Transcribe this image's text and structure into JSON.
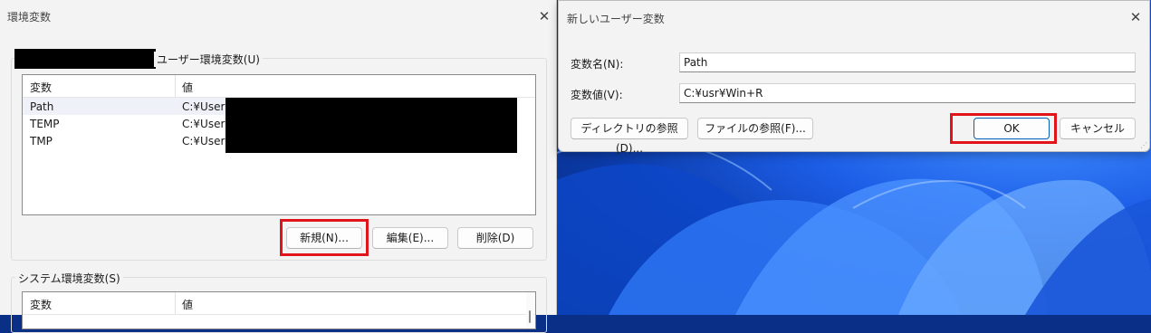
{
  "env_dialog": {
    "title": "環境変数",
    "user_section": {
      "label": "ユーザー環境変数(U)",
      "columns": [
        "変数",
        "値"
      ],
      "rows": [
        {
          "name": "Path",
          "value": "C:¥Users¥"
        },
        {
          "name": "TEMP",
          "value": "C:¥Users¥"
        },
        {
          "name": "TMP",
          "value": "C:¥Users¥"
        }
      ],
      "buttons": {
        "new": "新規(N)...",
        "edit": "編集(E)...",
        "delete": "削除(D)"
      }
    },
    "system_section": {
      "label": "システム環境変数(S)",
      "columns": [
        "変数",
        "値"
      ]
    }
  },
  "new_var_dialog": {
    "title": "新しいユーザー変数",
    "name_label": "変数名(N):",
    "name_value": "Path",
    "value_label": "変数値(V):",
    "value_value": "C:¥usr¥Win+R",
    "buttons": {
      "browse_dir": "ディレクトリの参照(D)...",
      "browse_file": "ファイルの参照(F)...",
      "ok": "OK",
      "cancel": "キャンセル"
    }
  },
  "icons": [
    "close-icon",
    "resize-grip-icon"
  ],
  "colors": {
    "highlight": "#e2141b",
    "wallpaper_blue": "#1c5de6",
    "dialog_bg": "#f3f3f3",
    "ok_border": "#005fb8"
  }
}
